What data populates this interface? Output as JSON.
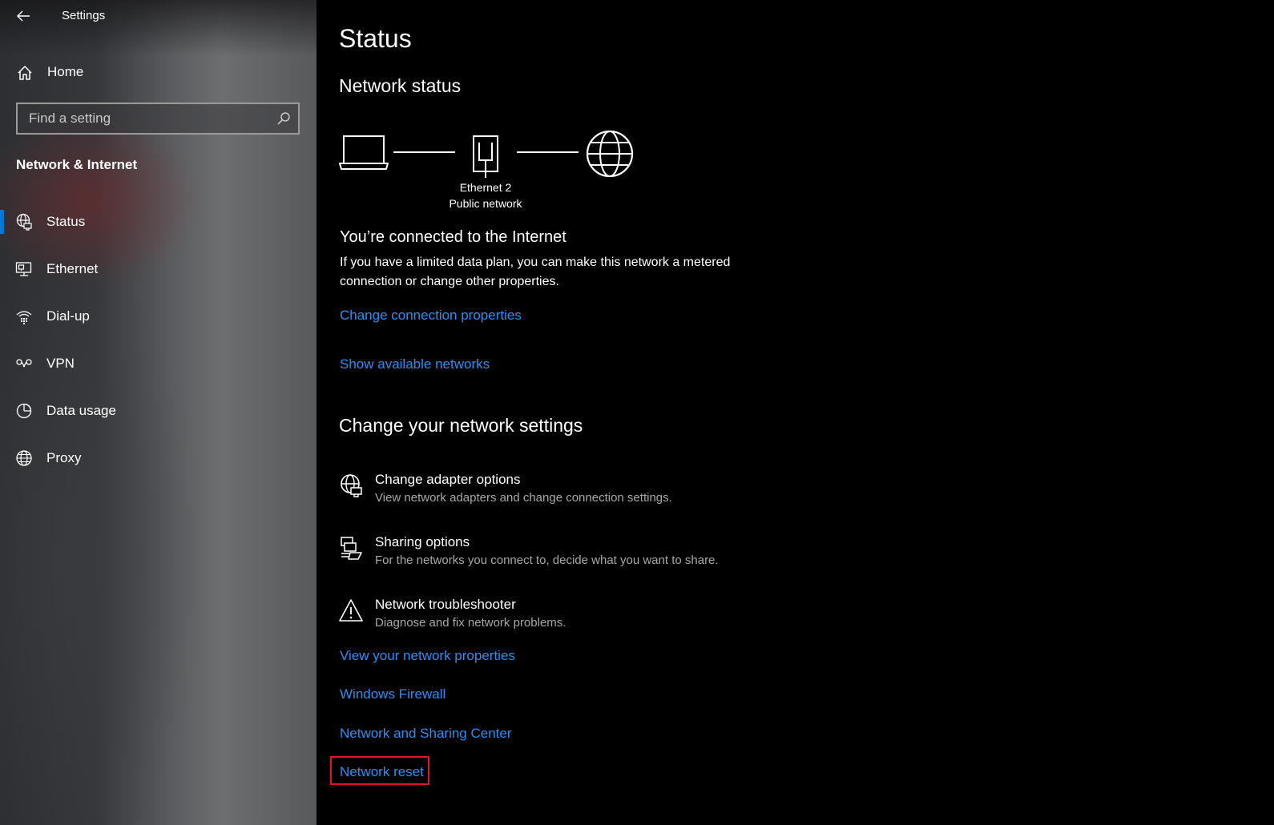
{
  "window": {
    "title": "Settings"
  },
  "sidebar": {
    "home_label": "Home",
    "search_placeholder": "Find a setting",
    "section_title": "Network & Internet",
    "items": [
      {
        "label": "Status",
        "icon": "status-globe-icon",
        "selected": true
      },
      {
        "label": "Ethernet",
        "icon": "ethernet-icon",
        "selected": false
      },
      {
        "label": "Dial-up",
        "icon": "dial-up-icon",
        "selected": false
      },
      {
        "label": "VPN",
        "icon": "vpn-icon",
        "selected": false
      },
      {
        "label": "Data usage",
        "icon": "data-usage-icon",
        "selected": false
      },
      {
        "label": "Proxy",
        "icon": "globe-icon",
        "selected": false
      }
    ]
  },
  "main": {
    "title": "Status",
    "network_status_heading": "Network status",
    "diagram": {
      "adapter_name": "Ethernet 2",
      "network_type": "Public network"
    },
    "connected_text": "You’re connected to the Internet",
    "connected_desc": "If you have a limited data plan, you can make this network a metered connection or change other properties.",
    "link_change_connection": "Change connection properties",
    "link_show_networks": "Show available networks",
    "change_settings_heading": "Change your network settings",
    "options": [
      {
        "title": "Change adapter options",
        "subtitle": "View network adapters and change connection settings.",
        "icon": "adapter-globe-icon"
      },
      {
        "title": "Sharing options",
        "subtitle": "For the networks you connect to, decide what you want to share.",
        "icon": "sharing-icon"
      },
      {
        "title": "Network troubleshooter",
        "subtitle": "Diagnose and fix network problems.",
        "icon": "warning-icon"
      }
    ],
    "links": [
      "View your network properties",
      "Windows Firewall",
      "Network and Sharing Center",
      "Network reset"
    ]
  },
  "colors": {
    "accent": "#0078d7",
    "link": "#2a8ff0",
    "highlight": "#e81123"
  }
}
